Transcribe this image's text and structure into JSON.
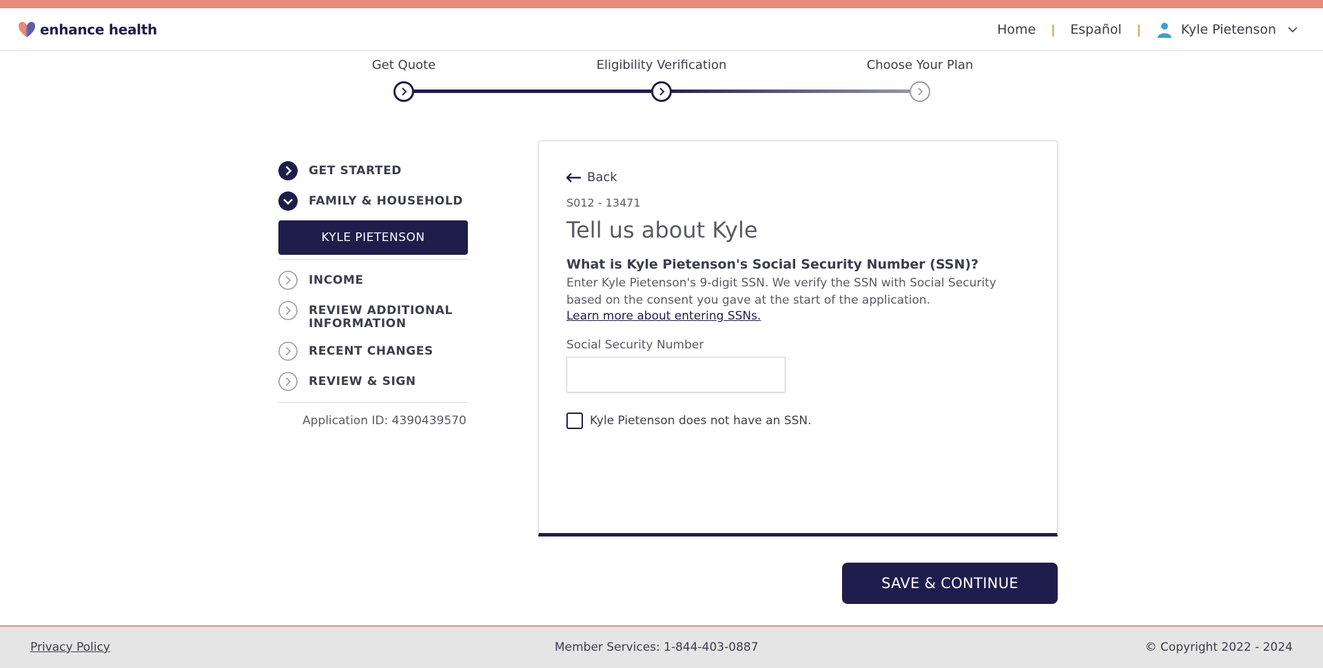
{
  "brand": {
    "name": "enhance health"
  },
  "nav": {
    "home": "Home",
    "language": "Español",
    "separator": "|",
    "user_name": "Kyle Pietenson"
  },
  "progress": {
    "steps": [
      {
        "label": "Get Quote",
        "state": "done"
      },
      {
        "label": "Eligibility Verification",
        "state": "done"
      },
      {
        "label": "Choose Your Plan",
        "state": "todo"
      }
    ]
  },
  "sidebar": {
    "items": [
      {
        "label": "GET STARTED",
        "state": "done"
      },
      {
        "label": "FAMILY & HOUSEHOLD",
        "state": "expanded"
      },
      {
        "label": "INCOME",
        "state": "todo"
      },
      {
        "label": "REVIEW ADDITIONAL INFORMATION",
        "state": "todo"
      },
      {
        "label": "RECENT CHANGES",
        "state": "todo"
      },
      {
        "label": "REVIEW & SIGN",
        "state": "todo"
      }
    ],
    "sub_item": "KYLE PIETENSON",
    "application_id": "Application ID: 4390439570"
  },
  "card": {
    "back": "Back",
    "case_id": "S012 - 13471",
    "title": "Tell us about Kyle",
    "question": "What is Kyle Pietenson's Social Security Number (SSN)?",
    "description": "Enter Kyle Pietenson's 9-digit SSN. We verify the SSN with Social Security based on the consent you gave at the start of the application.",
    "learn_more": "Learn more about entering SSNs.",
    "ssn_label": "Social Security Number",
    "ssn_value": "",
    "ssn_placeholder": "",
    "no_ssn_label": "Kyle Pietenson does not have an SSN."
  },
  "actions": {
    "save": "SAVE & CONTINUE"
  },
  "footer": {
    "privacy": "Privacy Policy",
    "member_services": "Member Services: 1-844-403-0887",
    "copyright": "© Copyright 2022 - 2024"
  },
  "colors": {
    "primary": "#1f1d4c",
    "accent": "#e88a79",
    "muted": "#9a9aa6",
    "footer_bg": "#e5e5e5"
  }
}
